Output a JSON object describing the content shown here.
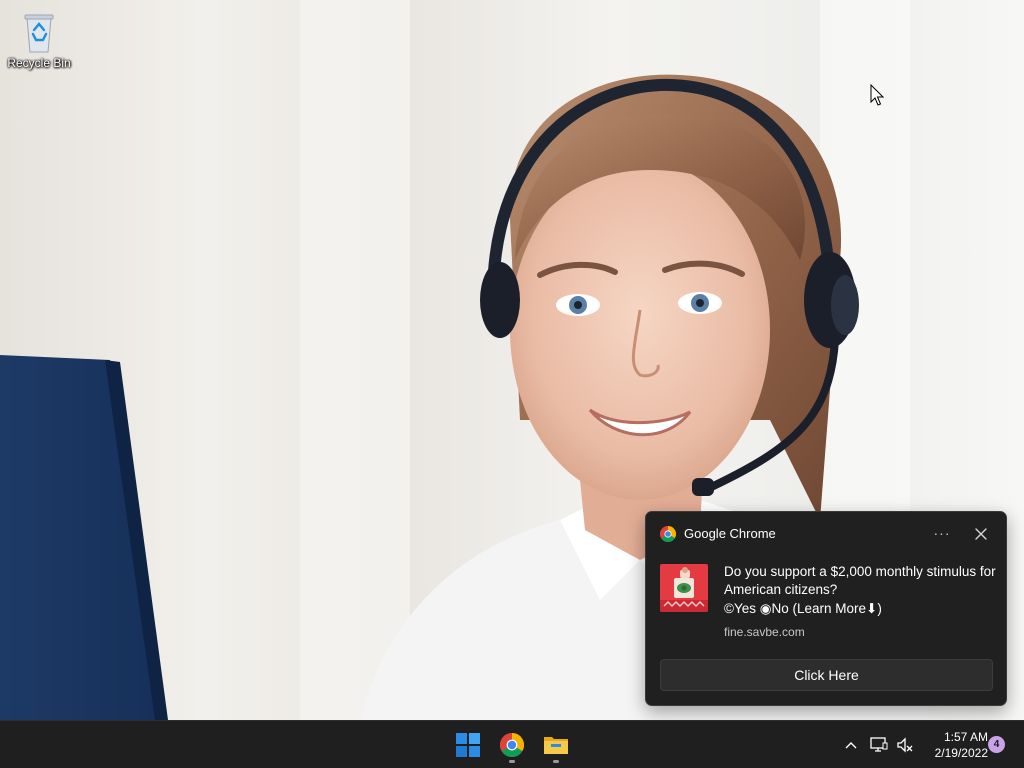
{
  "desktop": {
    "icons": [
      {
        "label": "Recycle Bin",
        "icon": "recycle-bin-icon"
      }
    ]
  },
  "notification": {
    "app_name": "Google Chrome",
    "app_icon": "chrome-icon",
    "more_label": "···",
    "close_icon": "close-icon",
    "thumbnail_icon": "stimulus-ad-thumbnail",
    "title": "Do you support a $2,000 monthly stimulus for American citizens?",
    "body": "©Yes  ◉No  (Learn More⬇)",
    "source": "fine.savbe.com",
    "action_label": "Click Here"
  },
  "taskbar": {
    "apps": [
      {
        "name": "Start",
        "icon": "windows-start-icon",
        "running": false
      },
      {
        "name": "Google Chrome",
        "icon": "chrome-icon",
        "running": true
      },
      {
        "name": "File Explorer",
        "icon": "folder-icon",
        "running": true
      }
    ],
    "tray": {
      "overflow_icon": "chevron-up-icon",
      "network_icon": "network-icon",
      "volume_icon": "volume-muted-icon",
      "time": "1:57 AM",
      "date": "2/19/2022",
      "notification_count": "4"
    }
  },
  "colors": {
    "taskbar_bg": "#1f1f1f",
    "toast_bg": "#202020",
    "action_button_bg": "#2d2d2d",
    "badge": "#c9a3e8",
    "windows_blue": "#2b8ce6"
  }
}
